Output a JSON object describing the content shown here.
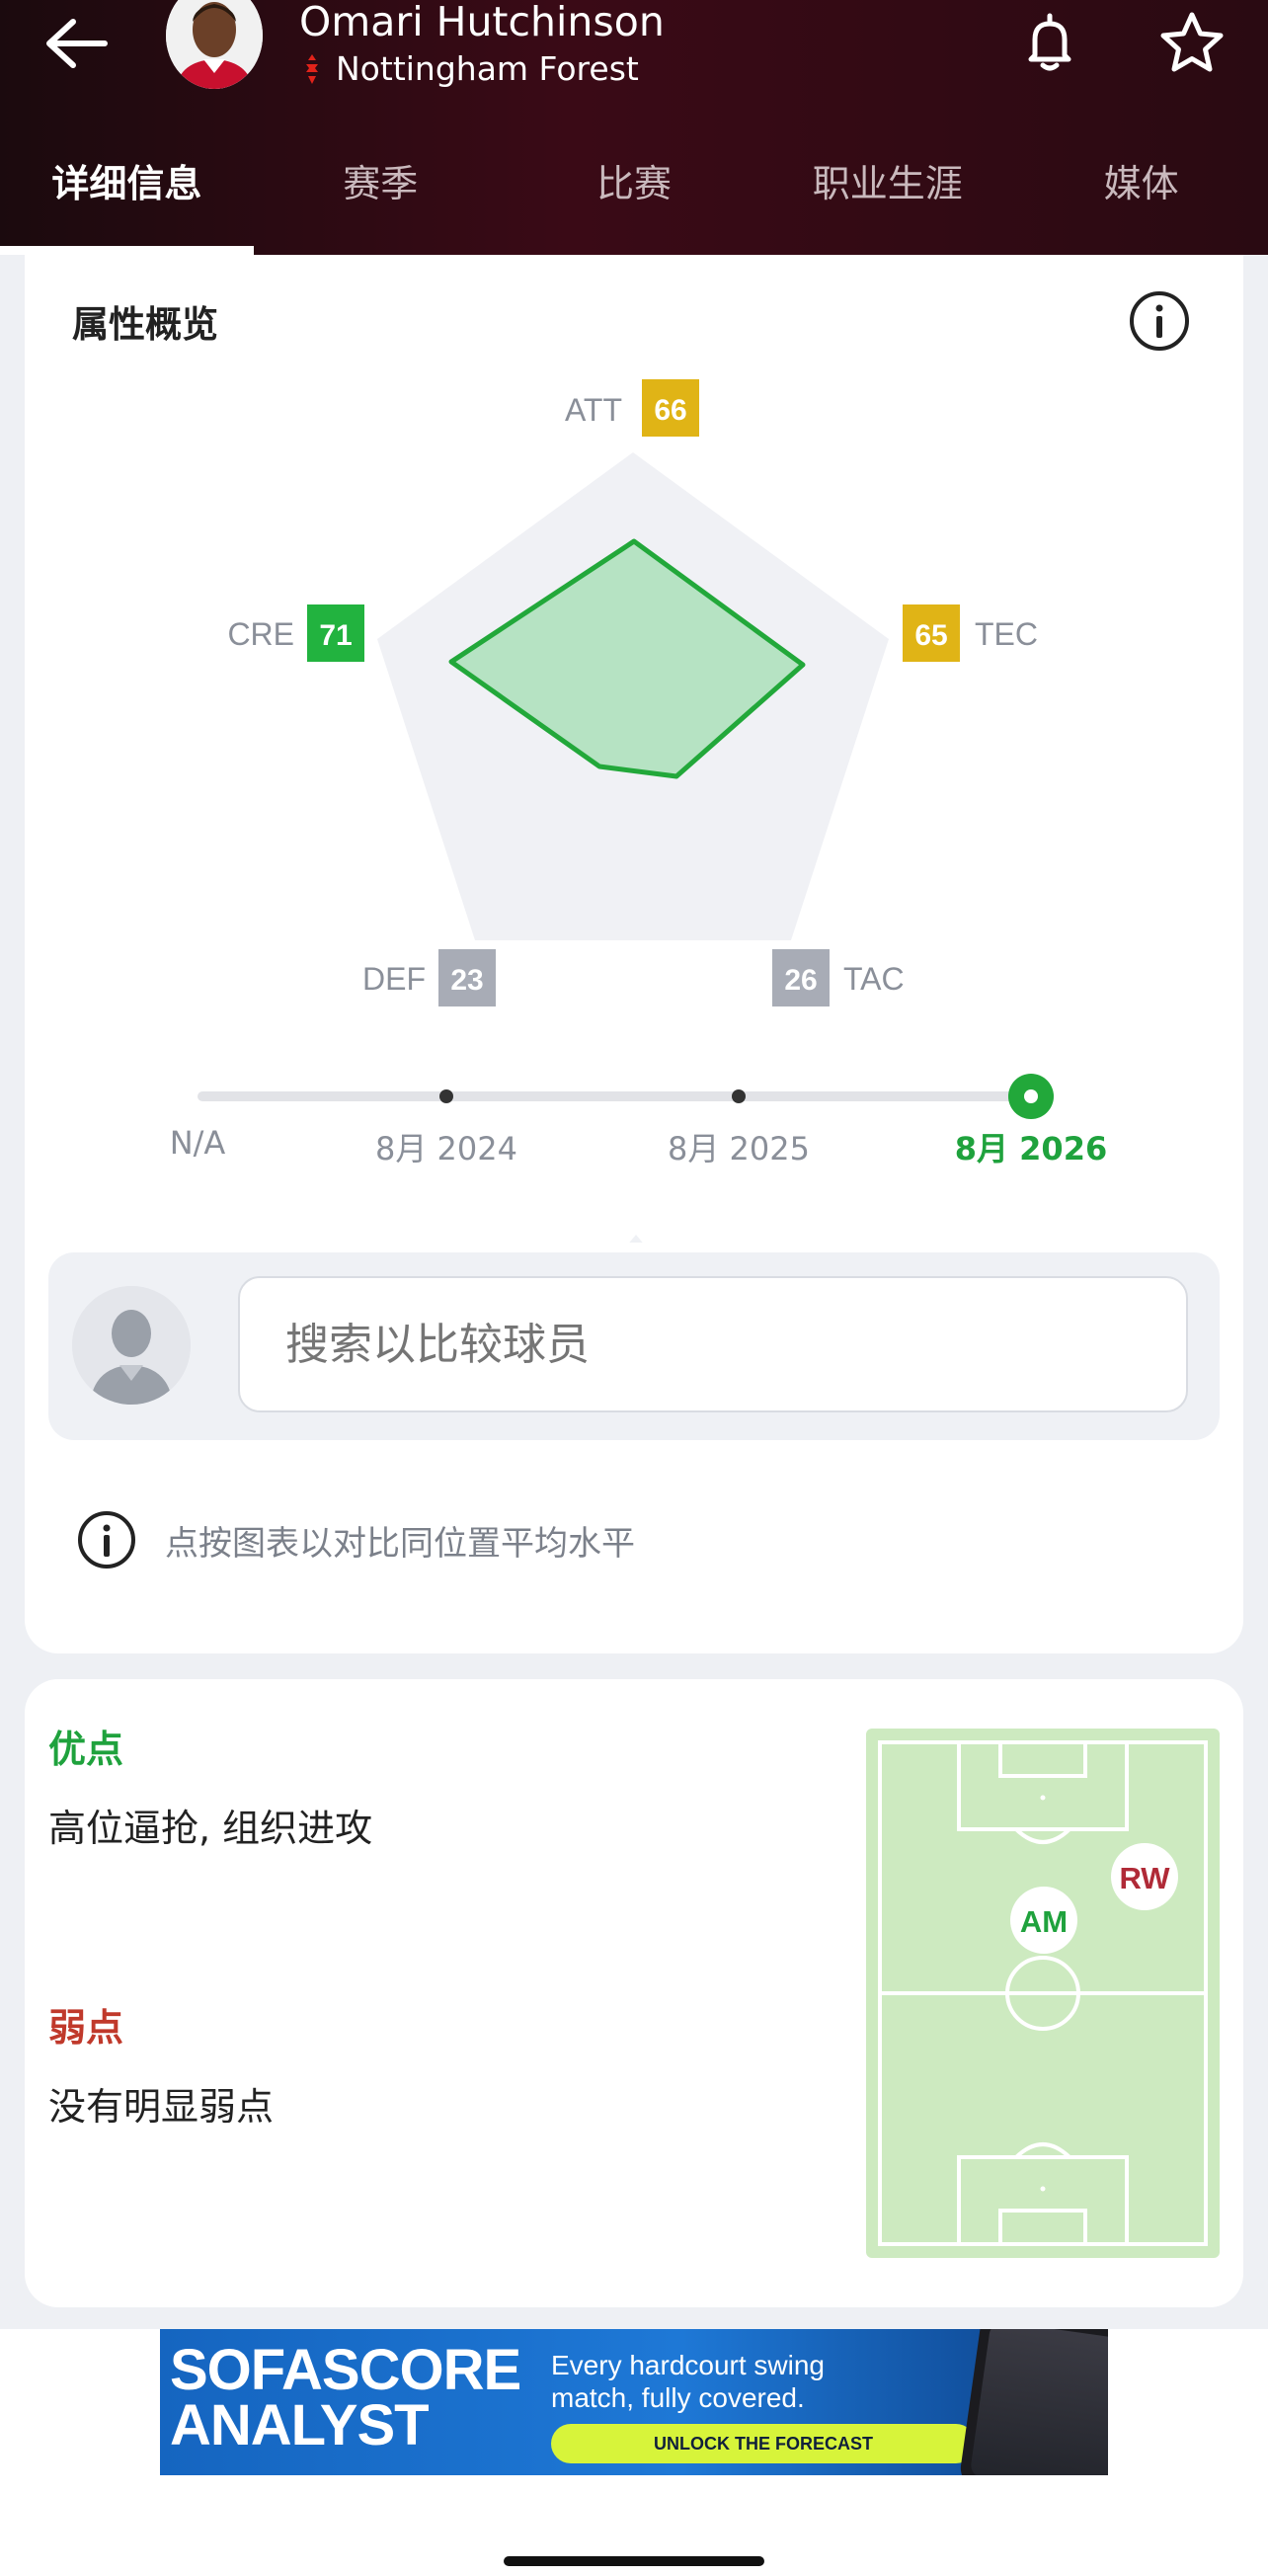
{
  "header": {
    "player_name": "Omari Hutchinson",
    "team_name": "Nottingham Forest",
    "colors": {
      "background": "#2a0a12",
      "text": "#ffffff"
    }
  },
  "tabs": [
    {
      "label": "详细信息",
      "active": true
    },
    {
      "label": "赛季",
      "active": false
    },
    {
      "label": "比赛",
      "active": false
    },
    {
      "label": "职业生涯",
      "active": false
    },
    {
      "label": "媒体",
      "active": false
    }
  ],
  "attributes_card": {
    "title": "属性概览",
    "attributes": [
      {
        "key": "ATT",
        "value": "66",
        "color": "#e0b416"
      },
      {
        "key": "TEC",
        "value": "65",
        "color": "#e0b416"
      },
      {
        "key": "TAC",
        "value": "26",
        "color": "#a8acb6"
      },
      {
        "key": "DEF",
        "value": "23",
        "color": "#a8acb6"
      },
      {
        "key": "CRE",
        "value": "71",
        "color": "#22b33f"
      }
    ],
    "timeline": [
      {
        "label": "N/A",
        "active": false
      },
      {
        "label": "8月 2024",
        "active": false
      },
      {
        "label": "8月 2025",
        "active": false
      },
      {
        "label": "8月 2026",
        "active": true
      }
    ],
    "compare_placeholder": "搜索以比较球员",
    "hint": "点按图表以对比同位置平均水平"
  },
  "strengths": {
    "strengths_label": "优点",
    "strengths_text": "高位逼抢, 组织进攻",
    "weaknesses_label": "弱点",
    "weaknesses_text": "没有明显弱点",
    "positions": [
      {
        "label": "AM",
        "primary": true
      },
      {
        "label": "RW",
        "primary": false
      }
    ],
    "colors": {
      "strength": "#1fa23d",
      "weakness": "#c0392b",
      "pitch": "#cdeac0"
    }
  },
  "ad": {
    "brand_line1": "SOFASCORE",
    "brand_line2": "ANALYST",
    "tagline": "Every hardcourt swing match, fully covered.",
    "cta": "UNLOCK THE FORECAST"
  }
}
